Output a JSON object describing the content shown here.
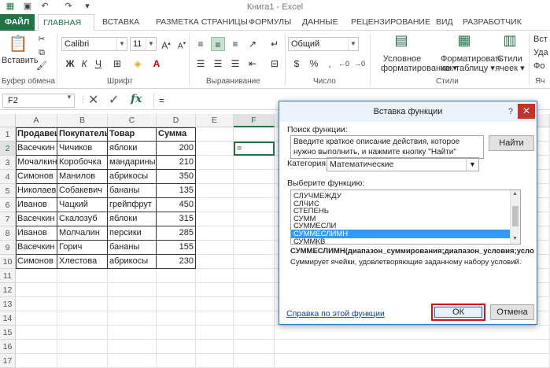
{
  "window": {
    "title": "Книга1 - Excel"
  },
  "tabs": [
    "ФАЙЛ",
    "ГЛАВНАЯ",
    "ВСТАВКА",
    "РАЗМЕТКА СТРАНИЦЫ",
    "ФОРМУЛЫ",
    "ДАННЫЕ",
    "РЕЦЕНЗИРОВАНИЕ",
    "ВИД",
    "РАЗРАБОТЧИК"
  ],
  "ribbon": {
    "clipboard": {
      "paste": "Вставить",
      "label": "Буфер обмена"
    },
    "font": {
      "name": "Calibri",
      "size": "11",
      "label": "Шрифт",
      "bold": "Ж",
      "italic": "К",
      "underline": "Ч"
    },
    "alignment": {
      "label": "Выравнивание"
    },
    "number": {
      "format": "Общий",
      "label": "Число"
    },
    "styles": {
      "label": "Стили",
      "conditional": [
        "Условное",
        "форматирование ▾"
      ],
      "table": [
        "Форматировать",
        "как таблицу ▾"
      ],
      "cell": [
        "Стили",
        "ячеек ▾"
      ],
      "partial": [
        "Вст",
        "Уда",
        "Фо",
        "Яч"
      ]
    }
  },
  "formula_bar": {
    "name_box": "F2",
    "fx": "fx",
    "value": "="
  },
  "sheet": {
    "columns": [
      "A",
      "B",
      "C",
      "D",
      "E",
      "F"
    ],
    "rows": [
      "1",
      "2",
      "3",
      "4",
      "5",
      "6",
      "7",
      "8",
      "9",
      "10",
      "11",
      "12",
      "13",
      "14",
      "15",
      "16",
      "17"
    ],
    "active_cell_value": "=",
    "headers": [
      "Продавец",
      "Покупатель",
      "Товар",
      "Сумма"
    ],
    "data": [
      [
        "Васечкин",
        "Чичиков",
        "яблоки",
        "200"
      ],
      [
        "Мочалкин",
        "Коробочка",
        "мандарины",
        "210"
      ],
      [
        "Симонов",
        "Манилов",
        "абрикосы",
        "350"
      ],
      [
        "Николаев",
        "Собакевич",
        "бананы",
        "135"
      ],
      [
        "Иванов",
        "Чацкий",
        "грейпфрут",
        "450"
      ],
      [
        "Васечкин",
        "Скалозуб",
        "яблоки",
        "315"
      ],
      [
        "Иванов",
        "Молчалин",
        "персики",
        "285"
      ],
      [
        "Васечкин",
        "Горич",
        "бананы",
        "155"
      ],
      [
        "Симонов",
        "Хлестова",
        "абрикосы",
        "230"
      ]
    ]
  },
  "dialog": {
    "title": "Вставка функции",
    "help": "?",
    "close": "✕",
    "search_label": "Поиск функции:",
    "search_placeholder": "Введите краткое описание действия, которое нужно выполнить, и нажмите кнопку \"Найти\"",
    "find_button": "Найти",
    "category_label": "Категория:",
    "category_value": "Математические",
    "select_label": "Выберите функцию:",
    "functions": [
      "СЛУЧМЕЖДУ",
      "СЛЧИС",
      "СТЕПЕНЬ",
      "СУММ",
      "СУММЕСЛИ",
      "СУММЕСЛИМН",
      "СУММКВ"
    ],
    "selected_function": "СУММЕСЛИМН",
    "signature": "СУММЕСЛИМН(диапазон_суммирования;диапазон_условия;условие;...)",
    "description": "Суммирует ячейки, удовлетворяющие заданному набору условий.",
    "help_link": "Справка по этой функции",
    "ok": "ОК",
    "cancel": "Отмена"
  }
}
